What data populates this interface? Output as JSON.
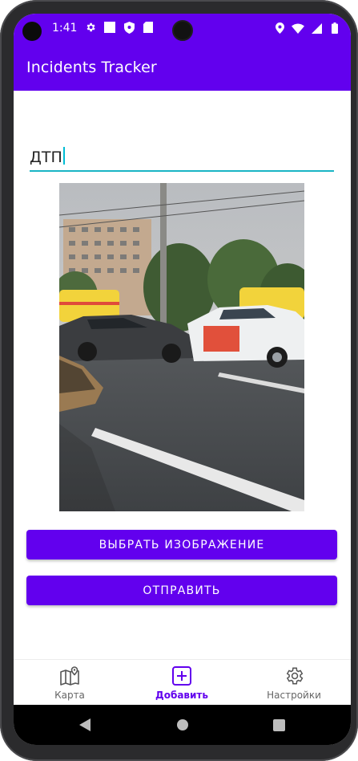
{
  "status_bar": {
    "time": "1:41",
    "left_icons": [
      "settings-icon",
      "square-notification-icon",
      "shield-icon",
      "sd-card-icon"
    ],
    "right_icons": [
      "location-icon",
      "wifi-icon",
      "signal-icon",
      "battery-icon"
    ]
  },
  "app_bar": {
    "title": "Incidents Tracker"
  },
  "form": {
    "title_value": "ДТП",
    "image_alt": "car-accident-photo"
  },
  "buttons": {
    "select_image": "ВЫБРАТЬ ИЗОБРАЖЕНИЕ",
    "send": "ОТПРАВИТЬ"
  },
  "bottom_nav": {
    "items": [
      {
        "label": "Карта",
        "icon": "map-icon",
        "active": false
      },
      {
        "label": "Добавить",
        "icon": "add-box-icon",
        "active": true
      },
      {
        "label": "Настройки",
        "icon": "gear-icon",
        "active": false
      }
    ]
  },
  "system_nav": {
    "buttons": [
      "back-icon",
      "home-icon",
      "recents-icon"
    ]
  },
  "colors": {
    "primary": "#6200ee",
    "accent_underline": "#19b5c5",
    "background": "#ffffff"
  }
}
